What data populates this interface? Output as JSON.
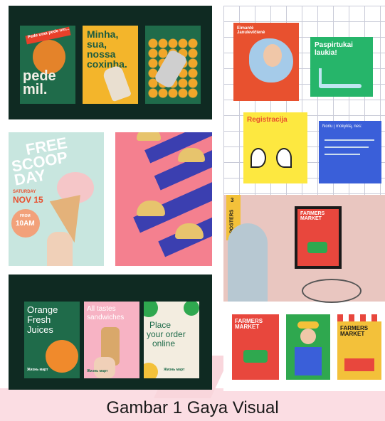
{
  "caption": "Gambar 1 Gaya Visual",
  "panel1": {
    "p1_title_lines": [
      "pede",
      "mil."
    ],
    "p1_ribbon": "Pede uma pede um...",
    "p2_title_lines": [
      "Minha,",
      "sua,",
      "nossa",
      "coxinha."
    ]
  },
  "panel2": {
    "p1_name": "Eimantė Janulevičienė",
    "p2_title": "Paspirtukai laukia!",
    "p3_title": "Registracija",
    "p4_text": "Noriu į mokyklą, nes:"
  },
  "panel3": {
    "title_lines": [
      "FREE",
      "SCOOP",
      "DAY"
    ],
    "day": "SATURDAY",
    "date": "NOV 15",
    "time_prefix": "FROM",
    "time": "10AM"
  },
  "panel5": {
    "side_label": "POSTERS",
    "side_number": "3",
    "poster_title": "FARMERS MARKET",
    "bottom_titles": [
      "FARMERS MARKET",
      "FARMERS MARKET",
      "FARMERS MARKET"
    ]
  },
  "panel6": {
    "p1_title_lines": [
      "Orange",
      "Fresh",
      "Juices"
    ],
    "p2_title_lines": [
      "All tastes",
      "sandwiches"
    ],
    "p3_title_lines": [
      "Place",
      "your order",
      "online"
    ],
    "brand": "Жизнь март"
  },
  "colors": {
    "dark_green": "#0f2a22",
    "pink": "#f7aab7",
    "mint": "#c8e6df",
    "pink_band": "#fbdde3"
  }
}
